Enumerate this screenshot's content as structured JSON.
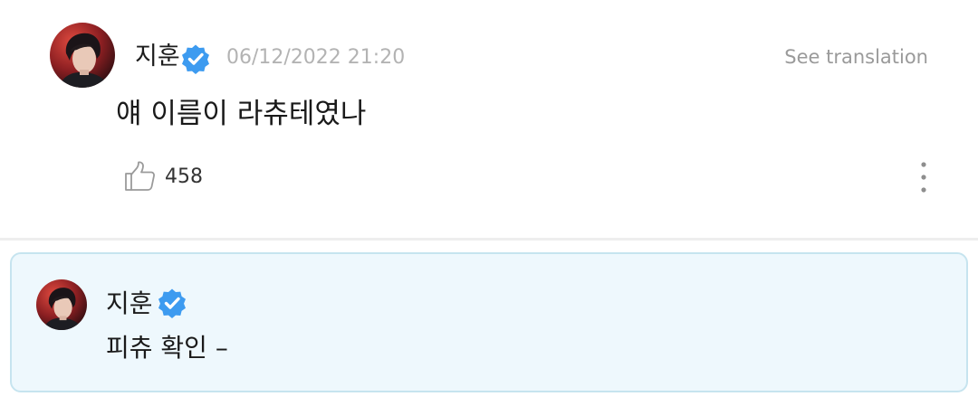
{
  "post": {
    "author": "지훈",
    "timestamp": "06/12/2022 21:20",
    "translate_label": "See translation",
    "content": "얘 이름이 라츄테였나",
    "like_count": "458"
  },
  "reply": {
    "author": "지훈",
    "content": "피츄 확인 –"
  },
  "icons": {
    "verified": "verified-badge-icon",
    "like": "thumbs-up-icon",
    "more": "more-vertical-icon"
  },
  "colors": {
    "verified_blue": "#3d9bf0",
    "reply_background": "#eef8fd",
    "reply_border": "#c6e4ef",
    "timestamp_gray": "#b3b3b3"
  }
}
